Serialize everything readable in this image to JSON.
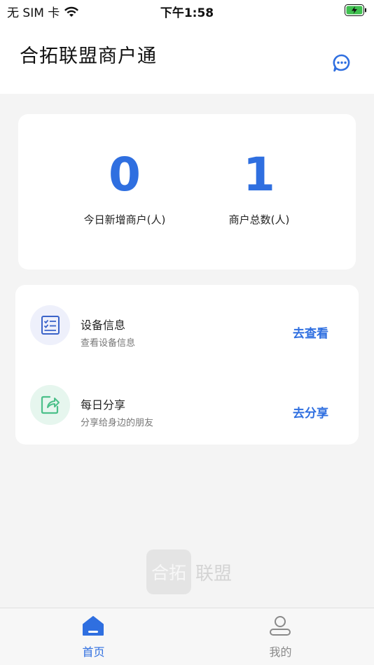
{
  "status_bar": {
    "carrier": "无 SIM 卡",
    "time": "下午1:58"
  },
  "header": {
    "title": "合拓联盟商户通",
    "message_icon": "chat-bubble-icon"
  },
  "stats": [
    {
      "value": "0",
      "label": "今日新增商户(人)"
    },
    {
      "value": "1",
      "label": "商户总数(人)"
    }
  ],
  "menu": [
    {
      "title": "设备信息",
      "subtitle": "查看设备信息",
      "action": "去查看",
      "icon": "checklist-icon"
    },
    {
      "title": "每日分享",
      "subtitle": "分享给身边的朋友",
      "action": "去分享",
      "icon": "share-icon"
    }
  ],
  "watermark": {
    "box_text": "合拓",
    "text": "联盟"
  },
  "tabbar": {
    "tabs": [
      {
        "label": "首页",
        "icon": "home-icon",
        "active": true
      },
      {
        "label": "我的",
        "icon": "user-icon",
        "active": false
      }
    ]
  },
  "colors": {
    "accent": "#2f6fe0",
    "inactive": "#8a8a8a",
    "menu_icon_bg_1": "#eef0fb",
    "menu_icon_bg_2": "#e6f6ee"
  }
}
